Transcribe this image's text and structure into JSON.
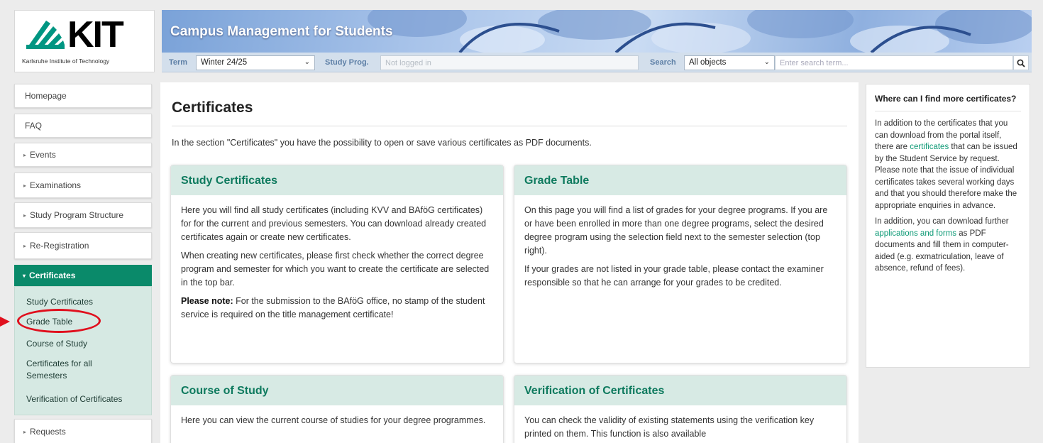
{
  "logo": {
    "text": "KIT",
    "subtitle": "Karlsruhe Institute of Technology"
  },
  "header": {
    "title": "Campus Management for Students"
  },
  "toolbar": {
    "term_label": "Term",
    "term_value": "Winter 24/25",
    "study_prog_label": "Study Prog.",
    "study_prog_placeholder": "Not logged in",
    "search_label": "Search",
    "search_scope": "All objects",
    "search_placeholder": "Enter search term..."
  },
  "sidebar": {
    "items": [
      {
        "label": "Homepage"
      },
      {
        "label": "FAQ"
      },
      {
        "label": "Events"
      },
      {
        "label": "Examinations"
      },
      {
        "label": "Study Program Structure"
      },
      {
        "label": "Re-Registration"
      }
    ],
    "active": "Certificates",
    "subitems": [
      {
        "label": "Study Certificates"
      },
      {
        "label": "Grade Table"
      },
      {
        "label": "Course of Study"
      },
      {
        "label": "Certificates for all Semesters"
      },
      {
        "label": "Verification of Certificates"
      }
    ],
    "after": [
      {
        "label": "Requests"
      }
    ]
  },
  "main": {
    "title": "Certificates",
    "intro": "In the section \"Certificates\" you have the possibility to open or save various certificates as PDF documents.",
    "cards": [
      {
        "title": "Study Certificates",
        "p1": "Here you will find all study certificates (including KVV and BAföG certificates) for for the current and previous semesters. You can download already created certificates again or create new certificates.",
        "p2": "When creating new certificates, please first check whether the correct degree program and semester for which you want to create the certificate are selected in the top bar.",
        "note_label": "Please note:",
        "note_text": " For the submission to the BAföG office, no stamp of the student service is required on the title management certificate!"
      },
      {
        "title": "Grade Table",
        "p1": "On this page you will find a list of grades for your degree programs. If you are or have been enrolled in more than one degree programs, select the desired degree program using the selection field next to the semester selection (top right).",
        "p2": "If your grades are not listed in your grade table, please contact the examiner responsible so that he can arrange for your grades to be credited."
      },
      {
        "title": "Course of Study",
        "p1": "Here you can view the current course of studies for your degree programmes."
      },
      {
        "title": "Verification of Certificates",
        "p1": "You can check the validity of existing statements using the verification key printed on them. This function is also available"
      }
    ]
  },
  "info": {
    "title": "Where can I find more certificates?",
    "p1_before": "In addition to the certificates that you can download from the portal itself, there are ",
    "p1_link": "certificates",
    "p1_after": " that can be issued by the Student Service by request. Please note that the issue of individual certificates takes several working days and that you should therefore make the appropriate enquiries in advance.",
    "p2_before": "In addition, you can download further ",
    "p2_link": "applications and forms",
    "p2_after": " as PDF documents and fill them in computer-aided (e.g. exmatriculation, leave of absence, refund of fees)."
  },
  "colors": {
    "accent": "#0a8a6a",
    "highlight": "#e0101e",
    "link": "#0e9a76"
  }
}
